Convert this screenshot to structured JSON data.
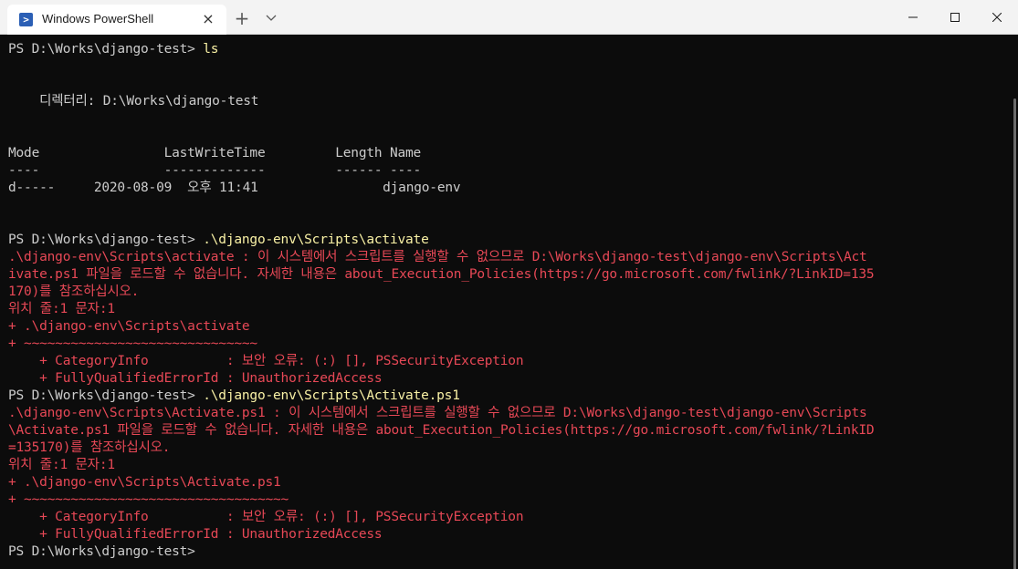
{
  "window": {
    "tab_title": "Windows PowerShell",
    "tab_icon": "powershell-icon",
    "tab_close": "×",
    "new_tab": "+",
    "controls": [
      "minimize-icon",
      "maximize-icon",
      "close-icon"
    ]
  },
  "colors": {
    "error": "#e74856",
    "command": "#f9f1a5",
    "text": "#cccccc",
    "background": "#0c0c0c"
  },
  "terminal": {
    "l0_prompt": "PS D:\\Works\\django-test> ",
    "l0_cmd": "ls",
    "l3": "    디렉터리: D:\\Works\\django-test",
    "l6": "Mode                LastWriteTime         Length Name",
    "l7": "----                -------------         ------ ----",
    "l8": "d-----     2020-08-09  오후 11:41                django-env",
    "l11_prompt": "PS D:\\Works\\django-test> ",
    "l11_cmd": ".\\django-env\\Scripts\\activate",
    "l12": ".\\django-env\\Scripts\\activate : 이 시스템에서 스크립트를 실행할 수 없으므로 D:\\Works\\django-test\\django-env\\Scripts\\Act",
    "l13": "ivate.ps1 파일을 로드할 수 없습니다. 자세한 내용은 about_Execution_Policies(https://go.microsoft.com/fwlink/?LinkID=135",
    "l14": "170)를 참조하십시오.",
    "l15": "위치 줄:1 문자:1",
    "l16": "+ .\\django-env\\Scripts\\activate",
    "l17": "+ ~~~~~~~~~~~~~~~~~~~~~~~~~~~~~~",
    "l18": "    + CategoryInfo          : 보안 오류: (:) [], PSSecurityException",
    "l19": "    + FullyQualifiedErrorId : UnauthorizedAccess",
    "l20_prompt": "PS D:\\Works\\django-test> ",
    "l20_cmd": ".\\django-env\\Scripts\\Activate.ps1",
    "l21": ".\\django-env\\Scripts\\Activate.ps1 : 이 시스템에서 스크립트를 실행할 수 없으므로 D:\\Works\\django-test\\django-env\\Scripts",
    "l22": "\\Activate.ps1 파일을 로드할 수 없습니다. 자세한 내용은 about_Execution_Policies(https://go.microsoft.com/fwlink/?LinkID",
    "l23": "=135170)를 참조하십시오.",
    "l24": "위치 줄:1 문자:1",
    "l25": "+ .\\django-env\\Scripts\\Activate.ps1",
    "l26": "+ ~~~~~~~~~~~~~~~~~~~~~~~~~~~~~~~~~~",
    "l27": "    + CategoryInfo          : 보안 오류: (:) [], PSSecurityException",
    "l28": "    + FullyQualifiedErrorId : UnauthorizedAccess",
    "l29_prompt": "PS D:\\Works\\django-test> "
  }
}
